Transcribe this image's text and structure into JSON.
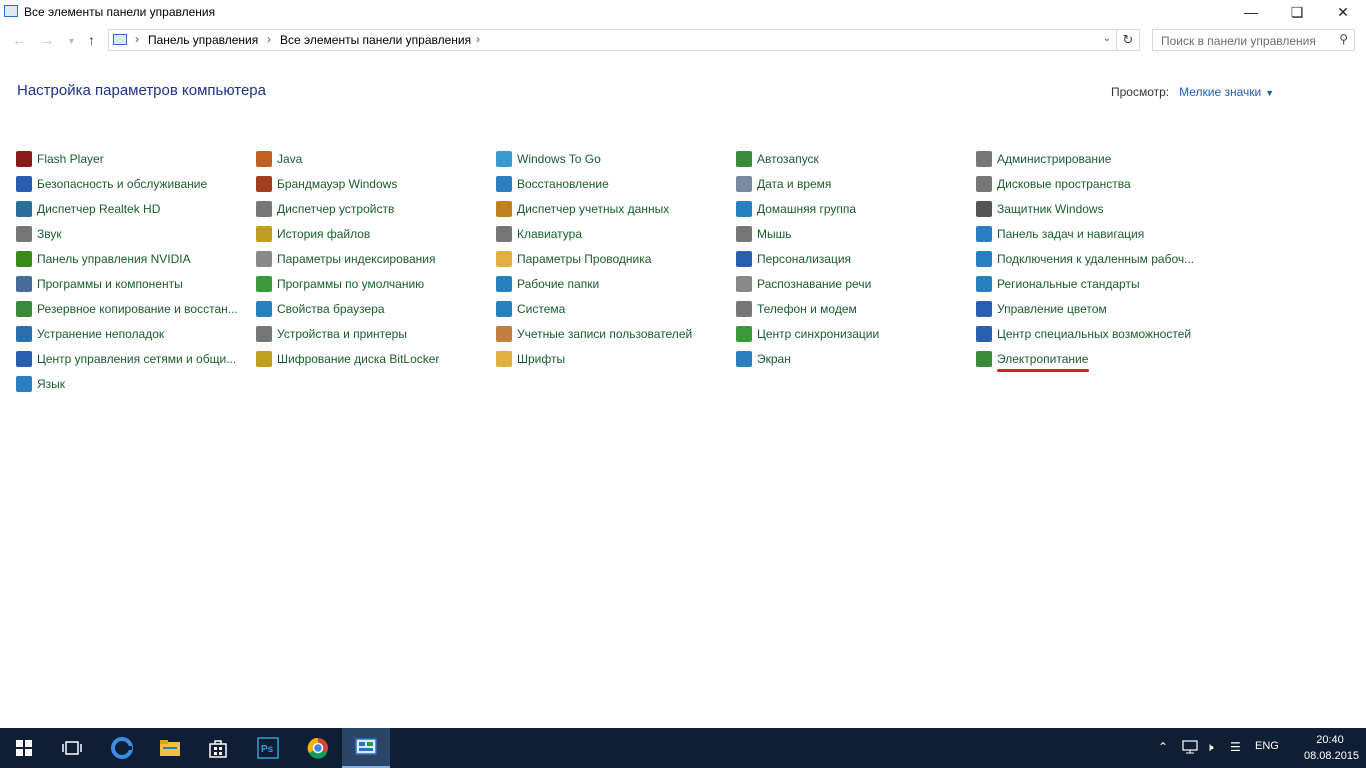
{
  "window": {
    "title": "Все элементы панели управления"
  },
  "breadcrumb": {
    "items": [
      "Панель управления",
      "Все элементы панели управления"
    ]
  },
  "search": {
    "placeholder": "Поиск в панели управления"
  },
  "header": {
    "title": "Настройка параметров компьютера",
    "view_label": "Просмотр:",
    "view_value": "Мелкие значки"
  },
  "columns": [
    [
      {
        "label": "Flash Player",
        "icon": "flash-icon",
        "color": "#8b1a1a"
      },
      {
        "label": "Безопасность и обслуживание",
        "icon": "flag-icon",
        "color": "#2a5fb0"
      },
      {
        "label": "Диспетчер Realtek HD",
        "icon": "realtek-icon",
        "color": "#2a6f9a"
      },
      {
        "label": "Звук",
        "icon": "speaker-icon",
        "color": "#777777"
      },
      {
        "label": "Панель управления NVIDIA",
        "icon": "nvidia-icon",
        "color": "#3a8a1a"
      },
      {
        "label": "Программы и компоненты",
        "icon": "programs-icon",
        "color": "#4a6a9a"
      },
      {
        "label": "Резервное копирование и восстан...",
        "icon": "backup-icon",
        "color": "#3a8a3a"
      },
      {
        "label": "Устранение неполадок",
        "icon": "troubleshoot-icon",
        "color": "#2a6fb0"
      },
      {
        "label": "Центр управления сетями и общи...",
        "icon": "network-icon",
        "color": "#2a5fb0"
      },
      {
        "label": "Язык",
        "icon": "language-icon",
        "color": "#2a7fc0"
      }
    ],
    [
      {
        "label": "Java",
        "icon": "java-icon",
        "color": "#c06020"
      },
      {
        "label": "Брандмауэр Windows",
        "icon": "firewall-icon",
        "color": "#a04020"
      },
      {
        "label": "Диспетчер устройств",
        "icon": "device-manager-icon",
        "color": "#777777"
      },
      {
        "label": "История файлов",
        "icon": "file-history-icon",
        "color": "#c0a020"
      },
      {
        "label": "Параметры индексирования",
        "icon": "indexing-icon",
        "color": "#888888"
      },
      {
        "label": "Программы по умолчанию",
        "icon": "default-programs-icon",
        "color": "#3a9a3a"
      },
      {
        "label": "Свойства браузера",
        "icon": "browser-icon",
        "color": "#2a7fc0"
      },
      {
        "label": "Устройства и принтеры",
        "icon": "printer-icon",
        "color": "#777777"
      },
      {
        "label": "Шифрование диска BitLocker",
        "icon": "bitlocker-icon",
        "color": "#c0a020"
      }
    ],
    [
      {
        "label": "Windows To Go",
        "icon": "windows-to-go-icon",
        "color": "#3a9ad0"
      },
      {
        "label": "Восстановление",
        "icon": "recovery-icon",
        "color": "#2a7fc0"
      },
      {
        "label": "Диспетчер учетных данных",
        "icon": "credential-icon",
        "color": "#c08020"
      },
      {
        "label": "Клавиатура",
        "icon": "keyboard-icon",
        "color": "#777777"
      },
      {
        "label": "Параметры Проводника",
        "icon": "folder-options-icon",
        "color": "#e0b040"
      },
      {
        "label": "Рабочие папки",
        "icon": "work-folders-icon",
        "color": "#2a7fc0"
      },
      {
        "label": "Система",
        "icon": "system-icon",
        "color": "#2a7fc0"
      },
      {
        "label": "Учетные записи пользователей",
        "icon": "users-icon",
        "color": "#c08040"
      },
      {
        "label": "Шрифты",
        "icon": "fonts-icon",
        "color": "#e0b040"
      }
    ],
    [
      {
        "label": "Автозапуск",
        "icon": "autoplay-icon",
        "color": "#3a8a3a"
      },
      {
        "label": "Дата и время",
        "icon": "clock-icon",
        "color": "#7a8aa0"
      },
      {
        "label": "Домашняя группа",
        "icon": "homegroup-icon",
        "color": "#2a7fc0"
      },
      {
        "label": "Мышь",
        "icon": "mouse-icon",
        "color": "#777777"
      },
      {
        "label": "Персонализация",
        "icon": "personalization-icon",
        "color": "#2a5fb0"
      },
      {
        "label": "Распознавание речи",
        "icon": "microphone-icon",
        "color": "#888888"
      },
      {
        "label": "Телефон и модем",
        "icon": "modem-icon",
        "color": "#777777"
      },
      {
        "label": "Центр синхронизации",
        "icon": "sync-icon",
        "color": "#3a9a3a"
      },
      {
        "label": "Экран",
        "icon": "display-icon",
        "color": "#2a7fc0"
      }
    ],
    [
      {
        "label": "Администрирование",
        "icon": "admin-tools-icon",
        "color": "#777777"
      },
      {
        "label": "Дисковые пространства",
        "icon": "storage-spaces-icon",
        "color": "#777777"
      },
      {
        "label": "Защитник Windows",
        "icon": "defender-icon",
        "color": "#555555"
      },
      {
        "label": "Панель задач и навигация",
        "icon": "taskbar-icon",
        "color": "#2a7fc0"
      },
      {
        "label": "Подключения к удаленным рабоч...",
        "icon": "remote-desktop-icon",
        "color": "#2a7fc0"
      },
      {
        "label": "Региональные стандарты",
        "icon": "region-icon",
        "color": "#2a7fc0"
      },
      {
        "label": "Управление цветом",
        "icon": "color-management-icon",
        "color": "#2a5fb0"
      },
      {
        "label": "Центр специальных возможностей",
        "icon": "accessibility-icon",
        "color": "#2a5fb0"
      },
      {
        "label": "Электропитание",
        "icon": "power-icon",
        "color": "#3a8a3a"
      }
    ]
  ],
  "taskbar": {
    "language": "ENG",
    "time": "20:40",
    "date": "08.08.2015"
  },
  "accent_color": "#1e3287",
  "link_color": "#1a5e2c"
}
